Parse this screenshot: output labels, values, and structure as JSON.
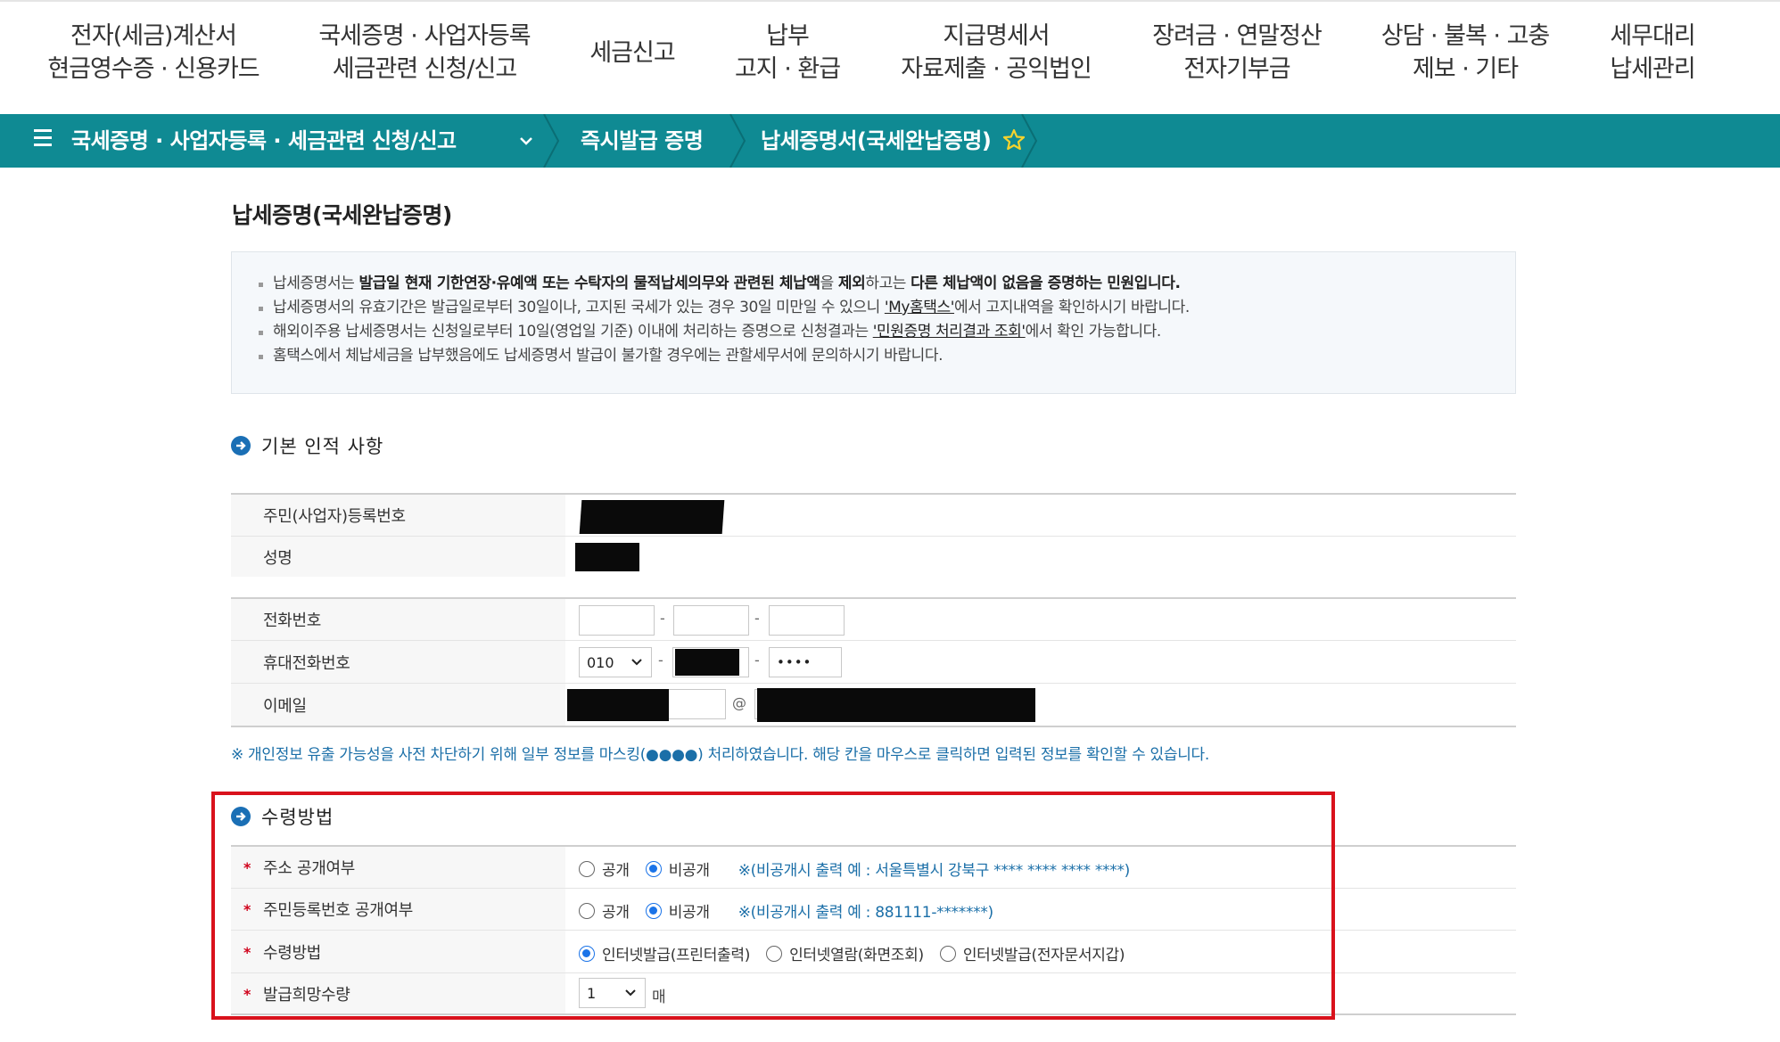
{
  "top_nav": [
    {
      "line1": "전자(세금)계산서",
      "line2": "현금영수증 · 신용카드"
    },
    {
      "line1": "국세증명 · 사업자등록",
      "line2": "세금관련 신청/신고"
    },
    {
      "line1": "세금신고",
      "line2": ""
    },
    {
      "line1": "납부",
      "line2": "고지 · 환급"
    },
    {
      "line1": "지급명세서",
      "line2": "자료제출 · 공익법인"
    },
    {
      "line1": "장려금 · 연말정산",
      "line2": "전자기부금"
    },
    {
      "line1": "상담 · 불복 · 고충",
      "line2": "제보 · 기타"
    },
    {
      "line1": "세무대리",
      "line2": "납세관리"
    }
  ],
  "breadcrumb": {
    "level1": "국세증명 · 사업자등록 · 세금관련 신청/신고",
    "level2": "즉시발급 증명",
    "level3": "납세증명서(국세완납증명)"
  },
  "page_title": "납세증명(국세완납증명)",
  "notice": {
    "line1_a": "납세증명서는 ",
    "line1_b": "발급일 현재 기한연장·유예액 또는 수탁자의 물적납세의무와 관련된 체납액",
    "line1_c": "을 ",
    "line1_d": "제외",
    "line1_e": "하고는 ",
    "line1_f": "다른 체납액이 없음을 증명하는 민원입니다.",
    "line2_a": "납세증명서의 유효기간은 발급일로부터 30일이나, 고지된 국세가 있는 경우 30일 미만일 수 있으니 ",
    "line2_link": "'My홈택스'",
    "line2_b": "에서 고지내역을 확인하시기 바랍니다.",
    "line3_a": "해외이주용 납세증명서는 신청일로부터 10일(영업일 기준) 이내에 처리하는 증명으로 신청결과는 ",
    "line3_link": "'민원증명 처리결과 조회'",
    "line3_b": "에서 확인 가능합니다.",
    "line4": "홈택스에서 체납세금을 납부했음에도 납세증명서 발급이 불가할 경우에는 관할세무서에 문의하시기 바랍니다."
  },
  "basic_section": {
    "title": "기본 인적 사항",
    "labels": {
      "rrn": "주민(사업자)등록번호",
      "name": "성명",
      "phone": "전화번호",
      "mobile": "휴대전화번호",
      "email": "이메일"
    },
    "phone_dash": "-",
    "mobile_prefix": "010",
    "mobile_last": "••••",
    "email_at": "@"
  },
  "privacy_note": "※ 개인정보 유출 가능성을 사전 차단하기 위해 일부 정보를 마스킹(●●●●) 처리하였습니다. 해당 칸을 마우스로 클릭하면 입력된 정보를 확인할 수 있습니다.",
  "receipt_section": {
    "title": "수령방법",
    "required_mark": "*",
    "address_label": "주소 공개여부",
    "rrn_label": "주민등록번호 공개여부",
    "method_label": "수령방법",
    "qty_label": "발급희망수량",
    "public": "공개",
    "private": "비공개",
    "address_hint": "※(비공개시 출력 예 : 서울특별시 강북구 **** **** **** ****)",
    "rrn_hint": "※(비공개시 출력 예 : 881111-*******)",
    "method_options": [
      "인터넷발급(프린터출력)",
      "인터넷열람(화면조회)",
      "인터넷발급(전자문서지갑)"
    ],
    "qty_value": "1",
    "qty_unit": "매"
  },
  "colors": {
    "breadcrumb_bg": "#0f8a93",
    "highlight_border": "#d9121c",
    "link_blue": "#1b6fa8",
    "radio_on": "#1a73e8"
  }
}
